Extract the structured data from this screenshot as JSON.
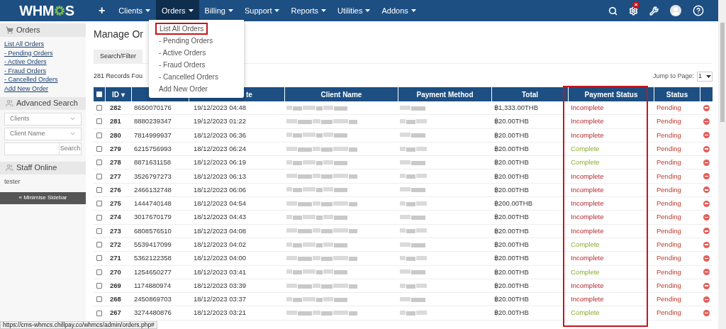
{
  "logo": {
    "text_before": "WHM",
    "text_after": "S"
  },
  "nav": {
    "add": "+",
    "items": [
      {
        "label": "Clients",
        "selected": false
      },
      {
        "label": "Orders",
        "selected": true
      },
      {
        "label": "Billing",
        "selected": false
      },
      {
        "label": "Support",
        "selected": false
      },
      {
        "label": "Reports",
        "selected": false
      },
      {
        "label": "Utilities",
        "selected": false
      },
      {
        "label": "Addons",
        "selected": false
      }
    ],
    "alert_badge": "×"
  },
  "dropdown": {
    "items": [
      {
        "label": "List All Orders",
        "highlighted": true
      },
      {
        "label": "- Pending Orders",
        "highlighted": false
      },
      {
        "label": "- Active Orders",
        "highlighted": false
      },
      {
        "label": "- Fraud Orders",
        "highlighted": false
      },
      {
        "label": "- Cancelled Orders",
        "highlighted": false
      },
      {
        "label": "Add New Order",
        "highlighted": false
      }
    ]
  },
  "sidebar": {
    "orders_title": "Orders",
    "links": [
      "List All Orders",
      "- Pending Orders",
      "- Active Orders",
      "- Fraud Orders",
      "- Cancelled Orders",
      "Add New Order"
    ],
    "advanced_search": {
      "title": "Advanced Search",
      "selects": [
        "Clients",
        "Client Name"
      ],
      "button": "Search"
    },
    "staff_online": {
      "title": "Staff Online",
      "users": [
        "tester"
      ]
    },
    "minimise": "« Minimise Sidebar"
  },
  "page": {
    "title": "Manage Or",
    "tabs": [
      "Search/Filter"
    ],
    "records": "281 Records Fou",
    "jump_label": "Jump to Page:",
    "jump_value": "1"
  },
  "table": {
    "columns": [
      "ID ▾",
      "",
      "te",
      "Client Name",
      "Payment Method",
      "Total",
      "Payment Status",
      "Status"
    ],
    "highlight_column": true,
    "select_all_checked": false,
    "rows": [
      {
        "id": "282",
        "number": "8650070176",
        "date": "19/12/2023 04:48",
        "total": "฿1,333.00THB",
        "payment_status": "Incomplete",
        "paid": false,
        "status": "Pending",
        "checked": false
      },
      {
        "id": "281",
        "number": "8880239347",
        "date": "19/12/2023 01:22",
        "total": "฿20.00THB",
        "payment_status": "Incomplete",
        "paid": false,
        "status": "Pending",
        "checked": false
      },
      {
        "id": "280",
        "number": "7814999937",
        "date": "18/12/2023 06:36",
        "total": "฿20.00THB",
        "payment_status": "Incomplete",
        "paid": false,
        "status": "Pending",
        "checked": false
      },
      {
        "id": "279",
        "number": "6215756993",
        "date": "18/12/2023 06:24",
        "total": "฿20.00THB",
        "payment_status": "Complete",
        "paid": true,
        "status": "Pending",
        "checked": false
      },
      {
        "id": "278",
        "number": "8871631158",
        "date": "18/12/2023 06:19",
        "total": "฿20.00THB",
        "payment_status": "Complete",
        "paid": true,
        "status": "Pending",
        "checked": false
      },
      {
        "id": "277",
        "number": "3526797273",
        "date": "18/12/2023 06:13",
        "total": "฿20.00THB",
        "payment_status": "Incomplete",
        "paid": false,
        "status": "Pending",
        "checked": false
      },
      {
        "id": "276",
        "number": "2466132748",
        "date": "18/12/2023 06:06",
        "total": "฿20.00THB",
        "payment_status": "Incomplete",
        "paid": false,
        "status": "Pending",
        "checked": false
      },
      {
        "id": "275",
        "number": "1444740148",
        "date": "18/12/2023 04:54",
        "total": "฿200.00THB",
        "payment_status": "Incomplete",
        "paid": false,
        "status": "Pending",
        "checked": false
      },
      {
        "id": "274",
        "number": "3017670179",
        "date": "18/12/2023 04:43",
        "total": "฿20.00THB",
        "payment_status": "Incomplete",
        "paid": false,
        "status": "Pending",
        "checked": false
      },
      {
        "id": "273",
        "number": "6808576510",
        "date": "18/12/2023 04:08",
        "total": "฿20.00THB",
        "payment_status": "Incomplete",
        "paid": false,
        "status": "Pending",
        "checked": false
      },
      {
        "id": "272",
        "number": "5539417099",
        "date": "18/12/2023 04:02",
        "total": "฿20.00THB",
        "payment_status": "Complete",
        "paid": true,
        "status": "Pending",
        "checked": false
      },
      {
        "id": "271",
        "number": "5362122358",
        "date": "18/12/2023 04:00",
        "total": "฿20.00THB",
        "payment_status": "Incomplete",
        "paid": false,
        "status": "Pending",
        "checked": false
      },
      {
        "id": "270",
        "number": "1254650277",
        "date": "18/12/2023 03:41",
        "total": "฿20.00THB",
        "payment_status": "Complete",
        "paid": true,
        "status": "Pending",
        "checked": false
      },
      {
        "id": "269",
        "number": "1174880974",
        "date": "18/12/2023 03:39",
        "total": "฿20.00THB",
        "payment_status": "Incomplete",
        "paid": false,
        "status": "Pending",
        "checked": false
      },
      {
        "id": "268",
        "number": "2450869703",
        "date": "18/12/2023 03:37",
        "total": "฿20.00THB",
        "payment_status": "Incomplete",
        "paid": false,
        "status": "Pending",
        "checked": false
      },
      {
        "id": "267",
        "number": "3274480876",
        "date": "18/12/2023 03:21",
        "total": "฿20.00THB",
        "payment_status": "Complete",
        "paid": true,
        "status": "Pending",
        "checked": false
      }
    ]
  },
  "status_url": "https://cms-whmcs.chillpay.co/whmcs/admin/orders.php#"
}
